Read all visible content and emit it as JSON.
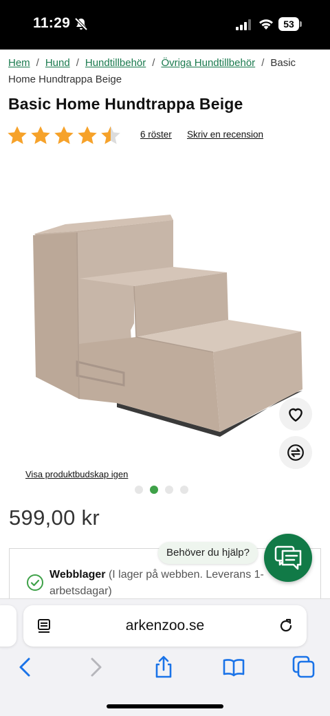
{
  "status_bar": {
    "time": "11:29",
    "battery": "53"
  },
  "breadcrumb": {
    "items": [
      "Hem",
      "Hund",
      "Hundtillbehör",
      "Övriga Hundtillbehör"
    ],
    "current_line1": "Basic",
    "current_line2": "Home Hundtrappa Beige",
    "separator": "/"
  },
  "product": {
    "title": "Basic Home Hundtrappa Beige",
    "rating_value": 4.5,
    "rating_max": 5,
    "votes_link": "6 röster",
    "review_link": "Skriv en recension",
    "price": "599,00 kr",
    "image_icon": "dog-stairs-image",
    "show_message_link": "Visa produktbudskap igen"
  },
  "carousel": {
    "count": 4,
    "active_index": 1
  },
  "stock": {
    "label": "Webblager",
    "detail": " (I lager på webben. Leverans 1-",
    "detail_line2": "arbetsdagar)"
  },
  "help": {
    "bubble_text": "Behöver du hjälp?"
  },
  "browser": {
    "url": "arkenzoo.se"
  },
  "colors": {
    "accent_green": "#117a47",
    "link_green": "#1a7a4e",
    "star_orange": "#f6a22a",
    "dot_active": "#3ea148",
    "ios_blue": "#1a73e8"
  }
}
